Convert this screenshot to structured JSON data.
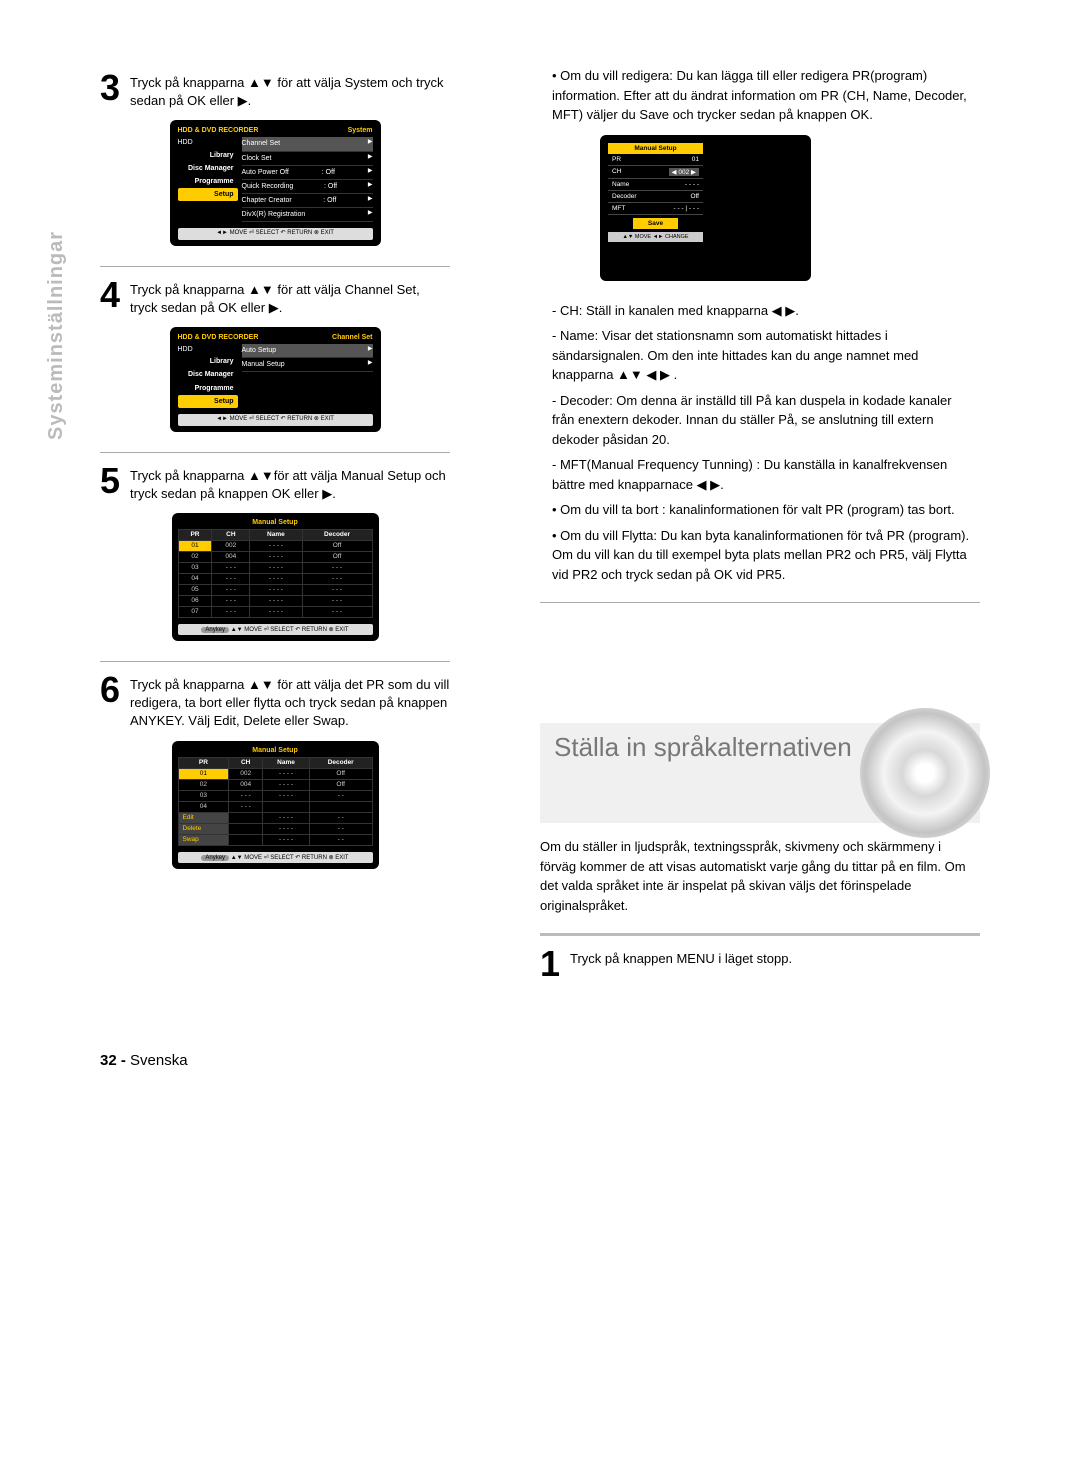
{
  "sidebar": {
    "label": "Systeminställningar"
  },
  "steps": {
    "3": {
      "text": "Tryck på knapparna ▲▼ för att välja System och tryck sedan på OK eller ▶."
    },
    "4": {
      "text": "Tryck på knapparna ▲▼ för att välja Channel Set, tryck sedan på OK eller ▶."
    },
    "5": {
      "text": "Tryck på knapparna ▲▼för att välja Manual Setup och tryck sedan på knappen OK eller ▶."
    },
    "6": {
      "text": "Tryck på knapparna ▲▼ för att välja det PR som du vill redigera, ta bort eller flytta och tryck sedan på knappen ANYKEY. Välj Edit, Delete eller Swap."
    }
  },
  "screen1": {
    "title_left": "HDD & DVD RECORDER",
    "title_right": "System",
    "hdd": "HDD",
    "left_items": [
      "Library",
      "Disc Manager",
      "Programme",
      "Setup"
    ],
    "rows": [
      {
        "label": "Channel Set",
        "val": "",
        "hl": true
      },
      {
        "label": "Clock Set",
        "val": ""
      },
      {
        "label": "Auto Power Off",
        "val": ": Off"
      },
      {
        "label": "Quick Recording",
        "val": ": Off"
      },
      {
        "label": "Chapter Creator",
        "val": ": Off"
      },
      {
        "label": "DivX(R) Registration",
        "val": ""
      }
    ],
    "footer": "◄► MOVE    ⏎ SELECT    ↶ RETURN    ⊗ EXIT"
  },
  "screen2": {
    "title_left": "HDD & DVD RECORDER",
    "title_right": "Channel Set",
    "hdd": "HDD",
    "left_items": [
      "Library",
      "Disc Manager",
      "Programme",
      "Setup"
    ],
    "rows": [
      {
        "label": "Auto Setup",
        "val": "",
        "hl": true
      },
      {
        "label": "Manual Setup",
        "val": ""
      }
    ],
    "footer": "◄► MOVE    ⏎ SELECT    ↶ RETURN    ⊗ EXIT"
  },
  "screen3": {
    "title": "Manual Setup",
    "headers": [
      "PR",
      "CH",
      "Name",
      "Decoder"
    ],
    "rows": [
      [
        "01",
        "002",
        "- - - -",
        "Off"
      ],
      [
        "02",
        "004",
        "- - - -",
        "Off"
      ],
      [
        "03",
        "- - -",
        "- - - -",
        "- - -"
      ],
      [
        "04",
        "- - -",
        "- - - -",
        "- - -"
      ],
      [
        "05",
        "- - -",
        "- - - -",
        "- - -"
      ],
      [
        "06",
        "- - -",
        "- - - -",
        "- - -"
      ],
      [
        "07",
        "- - -",
        "- - - -",
        "- - -"
      ]
    ],
    "anykey": "Anykey",
    "footer": "▲▼ MOVE    ⏎ SELECT    ↶ RETURN    ⊗ EXIT"
  },
  "screen4": {
    "title": "Manual Setup",
    "headers": [
      "PR",
      "CH",
      "Name",
      "Decoder"
    ],
    "rows": [
      [
        "01",
        "002",
        "- - - -",
        "Off"
      ],
      [
        "02",
        "004",
        "- - - -",
        "Off"
      ],
      [
        "03",
        "- - -",
        "- - - -",
        "- -"
      ],
      [
        "04",
        "- - -",
        "",
        ""
      ]
    ],
    "edit_items": [
      "Edit",
      "Delete",
      "Swap"
    ],
    "edit_rows": [
      [
        "",
        "- - - -",
        "- -"
      ],
      [
        "",
        "- - - -",
        "- -"
      ],
      [
        "",
        "- - - -",
        "- -"
      ]
    ],
    "anykey": "Anykey",
    "footer": "▲▼ MOVE    ⏎ SELECT    ↶ RETURN    ⊗ EXIT"
  },
  "right": {
    "bullet_top": "• Om du vill redigera: Du kan lägga till eller redigera PR(program) information. Efter att du ändrat information om PR (CH, Name, Decoder, MFT) väljer du Save och trycker sedan på knappen OK.",
    "small_screen": {
      "title": "Manual Setup",
      "rows": [
        {
          "k": "PR",
          "v": "01"
        },
        {
          "k": "CH",
          "v": "◀ 002 ▶"
        },
        {
          "k": "Name",
          "v": "- - - -"
        },
        {
          "k": "Decoder",
          "v": "Off"
        },
        {
          "k": "MFT",
          "v": "- - - | - - -"
        }
      ],
      "save": "Save",
      "footer": "▲▼ MOVE    ◄► CHANGE"
    },
    "bullets2": {
      "ch": "- CH: Ställ in kanalen med knapparna ◀ ▶.",
      "name": "- Name: Visar det stationsnamn som automatiskt hittades i sändarsignalen. Om den inte hittades kan du ange namnet med knapparna ▲▼ ◀ ▶ .",
      "decoder": "- Decoder: Om denna är inställd till På kan duspela in kodade kanaler från enextern dekoder. Innan du ställer På, se anslutning till extern dekoder påsidan 20.",
      "mft": "- MFT(Manual Frequency Tunning) : Du kanställa in kanalfrekvensen bättre med knapparnace ◀ ▶.",
      "del": "• Om du vill ta bort : kanalinformationen för valt PR (program) tas bort.",
      "move": "• Om du vill Flytta: Du kan byta kanalinformationen för två PR (program). Om du vill kan du till exempel byta plats mellan PR2 och PR5, välj Flytta vid PR2 och tryck sedan på OK vid PR5."
    },
    "heading": "Ställa in språkalternativen",
    "intro": "Om du ställer in ljudspråk, textningsspråk, skivmeny och skärmmeny i förväg kommer de att visas automatiskt varje gång du tittar på en film. Om det valda språket inte är inspelat på skivan väljs det förinspelade originalspråket.",
    "step1": "Tryck på knappen MENU i läget stopp."
  },
  "footer": {
    "page": "32 -",
    "lang": "Svenska"
  }
}
